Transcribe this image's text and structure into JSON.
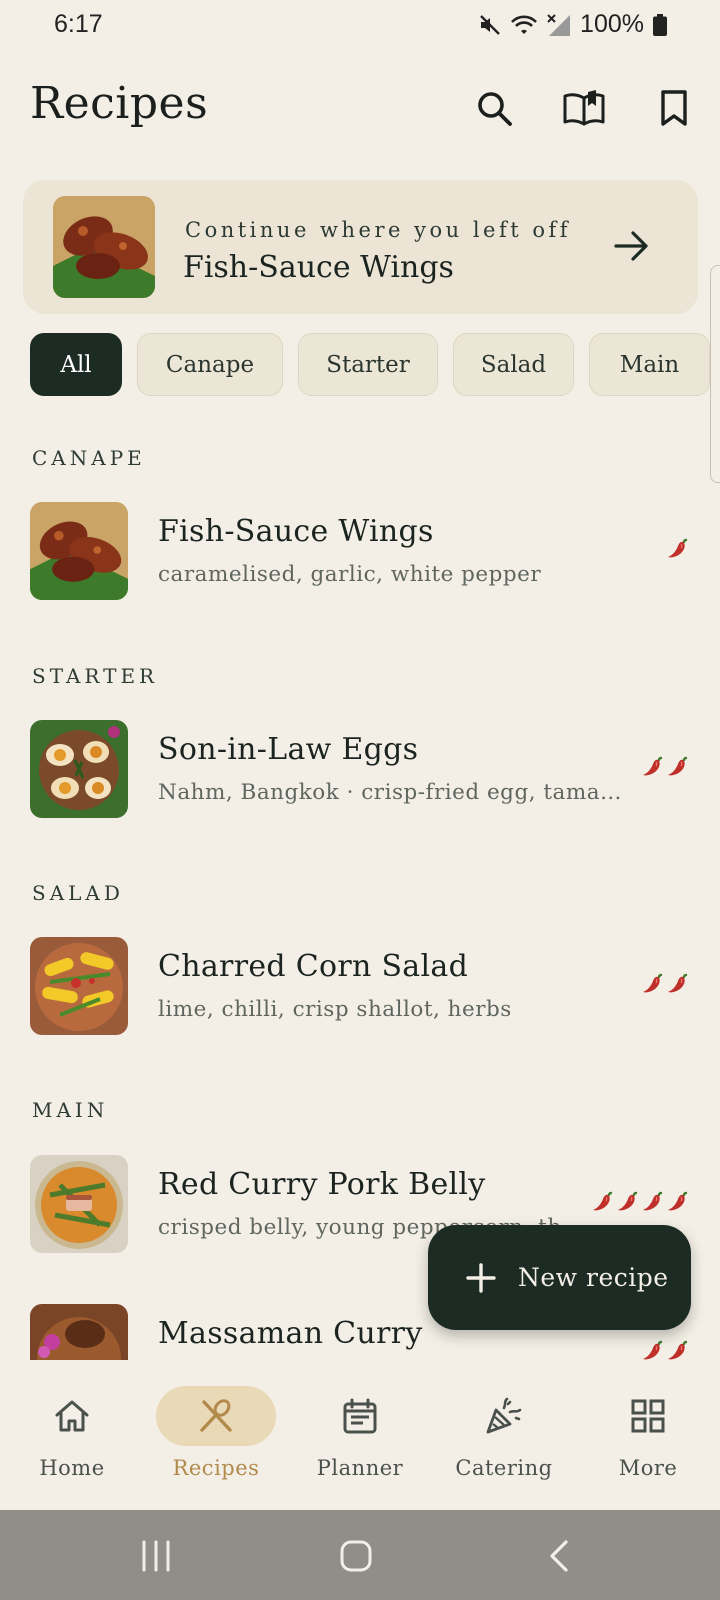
{
  "status": {
    "time": "6:17",
    "battery": "100%"
  },
  "header": {
    "title": "Recipes"
  },
  "continue": {
    "kicker": "Continue where you left off",
    "title": "Fish-Sauce Wings"
  },
  "chips": [
    {
      "label": "All",
      "active": true
    },
    {
      "label": "Canape",
      "active": false
    },
    {
      "label": "Starter",
      "active": false
    },
    {
      "label": "Salad",
      "active": false
    },
    {
      "label": "Main",
      "active": false
    }
  ],
  "sections": [
    {
      "label": "CANAPE",
      "recipes": [
        {
          "title": "Fish-Sauce Wings",
          "subtitle": "caramelised, garlic, white pepper",
          "spice": 1
        }
      ]
    },
    {
      "label": "STARTER",
      "recipes": [
        {
          "title": "Son-in-Law Eggs",
          "subtitle": "Nahm, Bangkok  ·  crisp-fried egg, tama…",
          "spice": 2
        }
      ]
    },
    {
      "label": "SALAD",
      "recipes": [
        {
          "title": "Charred Corn Salad",
          "subtitle": "lime, chilli, crisp shallot, herbs",
          "spice": 2
        }
      ]
    },
    {
      "label": "MAIN",
      "recipes": [
        {
          "title": "Red Curry Pork Belly",
          "subtitle": "crisped belly, young peppercorn, th…",
          "spice": 4
        },
        {
          "title": "Massaman Curry",
          "subtitle": "",
          "spice": 2
        }
      ]
    }
  ],
  "fab": {
    "label": "New recipe"
  },
  "nav": [
    {
      "label": "Home",
      "icon": "home-icon",
      "active": false
    },
    {
      "label": "Recipes",
      "icon": "utensils-icon",
      "active": true
    },
    {
      "label": "Planner",
      "icon": "calendar-icon",
      "active": false
    },
    {
      "label": "Catering",
      "icon": "party-popper-icon",
      "active": false
    },
    {
      "label": "More",
      "icon": "grid-icon",
      "active": false
    }
  ],
  "colors": {
    "background": "#f3efe6",
    "primary": "#1c2c24",
    "accent": "#b18a4c",
    "accent_pill": "#ead9b6",
    "chili": "#c0302b"
  }
}
